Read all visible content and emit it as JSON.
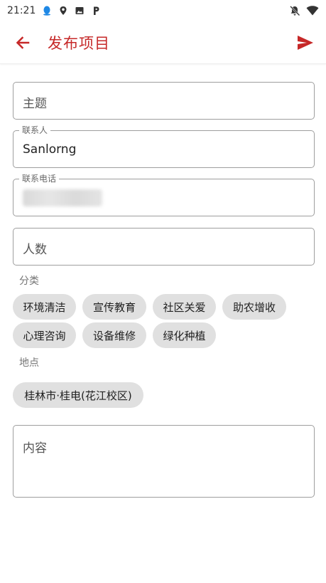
{
  "status_bar": {
    "time": "21:21",
    "left_icons": [
      "qq-icon",
      "location-icon",
      "image-icon",
      "parking-icon"
    ],
    "right_icons": [
      "bell-off-icon",
      "wifi-icon"
    ]
  },
  "app_bar": {
    "title": "发布项目",
    "back_icon": "arrow-left-icon",
    "send_icon": "send-icon",
    "accent_color": "#c62828"
  },
  "form": {
    "subject": {
      "placeholder": "主题"
    },
    "contact": {
      "label": "联系人",
      "value": "Sanlorng"
    },
    "phone": {
      "label": "联系电话",
      "value": ""
    },
    "count": {
      "placeholder": "人数"
    },
    "category_label": "分类",
    "categories": [
      "环境清洁",
      "宣传教育",
      "社区关爱",
      "助农增收",
      "心理咨询",
      "设备维修",
      "绿化种植"
    ],
    "location_label": "地点",
    "location": "桂林市·桂电(花江校区)",
    "content": {
      "placeholder": "内容"
    }
  }
}
